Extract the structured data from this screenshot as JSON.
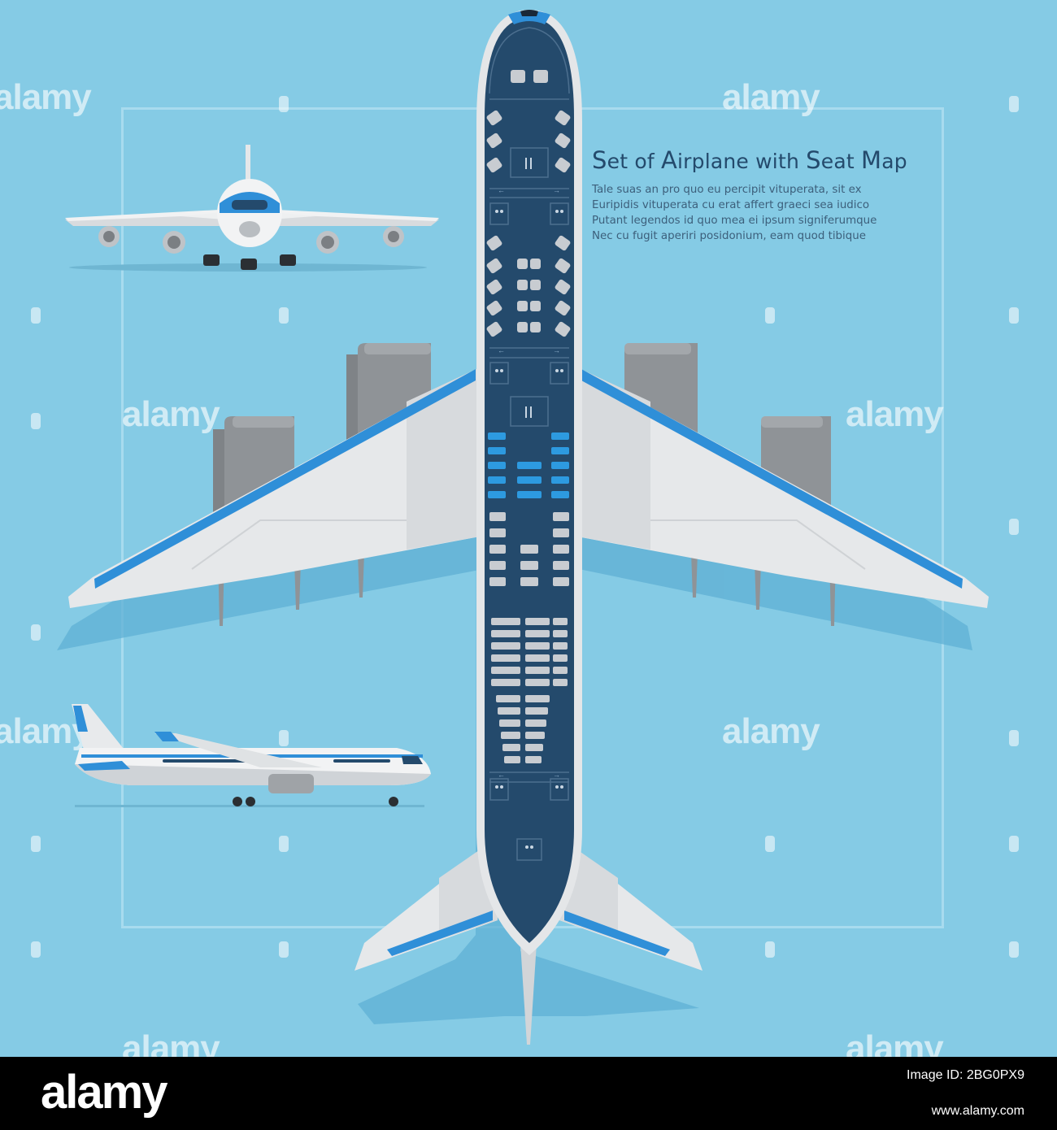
{
  "title": {
    "set_cap": "S",
    "set_rest": "et of ",
    "airplane_cap": "A",
    "airplane_rest": "irplane with ",
    "seat_cap": "S",
    "seat_rest": "eat ",
    "map_cap": "M",
    "map_rest": "ap"
  },
  "description_lines": [
    "Tale suas an pro quo eu percipit vituperata, sit ex",
    "Euripidis vituperata cu erat affert graeci sea iudico",
    "Putant legendos id quo mea ei ipsum signiferumque",
    "Nec cu fugit aperiri posidonium, eam quod tibique"
  ],
  "watermark": "alamy",
  "footer": {
    "logo": "alamy",
    "image_id": "Image ID: 2BG0PX9",
    "url": "www.alamy.com"
  },
  "colors": {
    "background": "#85cbe5",
    "fuselage": "#244a6c",
    "wing": "#e6e8ea",
    "accent_stripe": "#2f8fd8",
    "engine": "#8f9397",
    "economy_seat": "#c8ccd1",
    "premium_seat": "#2d9ae0",
    "title": "#244a6c"
  }
}
